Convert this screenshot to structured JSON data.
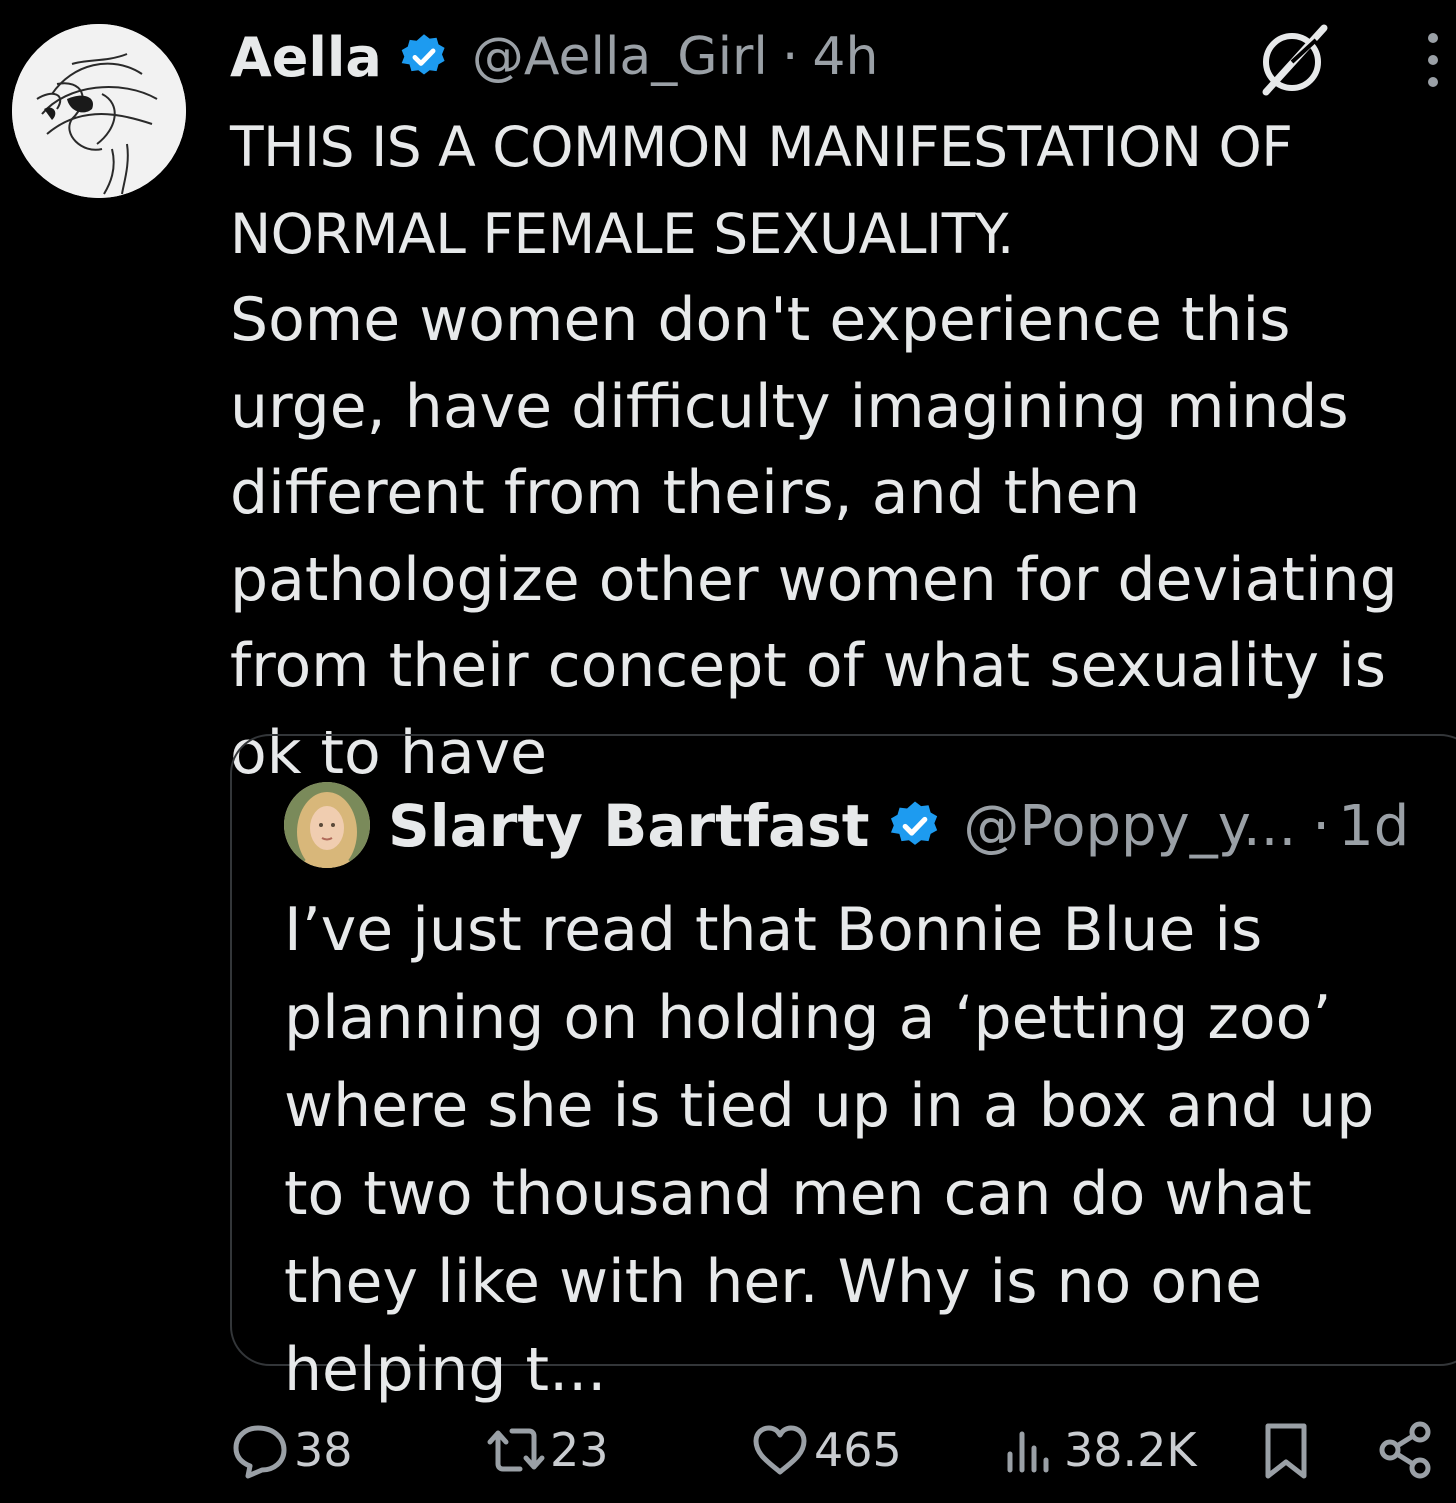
{
  "tweet": {
    "author_name": "Aella",
    "handle": "@Aella_Girl",
    "time": "4h",
    "text_caps_1": "THIS IS A COMMON MANIFESTATION OF",
    "text_caps_2": "NORMAL FEMALE SEXUALITY.",
    "text_body": "Some women don't experience this urge, have difficulty imagining minds different from theirs, and then pathologize other women for deviating from their concept of what sexuality is ok to have"
  },
  "quote": {
    "author_name": "Slarty Bartfast",
    "handle": "@Poppy_y...",
    "time": "1d",
    "text": "I’ve just read that Bonnie Blue is planning on holding a ‘petting zoo’ where she is tied up in a box and up to two thousand men can do what they like with her. Why is no one helping t..."
  },
  "actions": {
    "replies": "38",
    "reposts": "23",
    "likes": "465",
    "views": "38.2K"
  },
  "icons": {
    "verified": "verified-badge-icon",
    "grok": "grok-icon",
    "more": "more-icon",
    "reply": "reply-icon",
    "repost": "repost-icon",
    "like": "like-icon",
    "views": "views-icon",
    "bookmark": "bookmark-icon",
    "share": "share-icon"
  },
  "colors": {
    "background": "#000000",
    "text": "#e7e9ea",
    "secondary": "#9aa0a6",
    "verified": "#1d9bf0",
    "border": "#333639"
  }
}
